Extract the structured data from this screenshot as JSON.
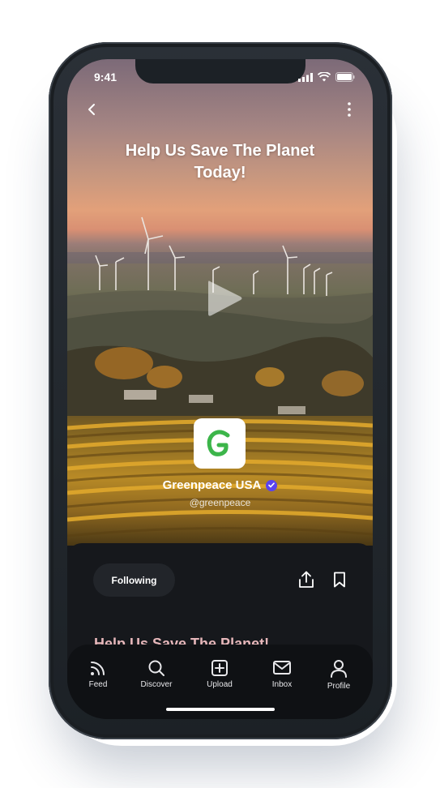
{
  "status_bar": {
    "time": "9:41"
  },
  "hero": {
    "title": "Help Us Save The Planet Today!"
  },
  "organization": {
    "name": "Greenpeace USA",
    "handle": "@greenpeace",
    "logo_letter": "G",
    "verified": true,
    "logo_color": "#3cb54a",
    "verified_color": "#5a43f0"
  },
  "actions": {
    "follow_label": "Following"
  },
  "description": {
    "title": "Help Us Save The Planet!"
  },
  "tabbar": {
    "items": [
      {
        "label": "Feed",
        "icon": "feed-icon"
      },
      {
        "label": "Discover",
        "icon": "search-icon"
      },
      {
        "label": "Upload",
        "icon": "upload-icon"
      },
      {
        "label": "Inbox",
        "icon": "inbox-icon"
      },
      {
        "label": "Profile",
        "icon": "profile-icon"
      }
    ]
  }
}
